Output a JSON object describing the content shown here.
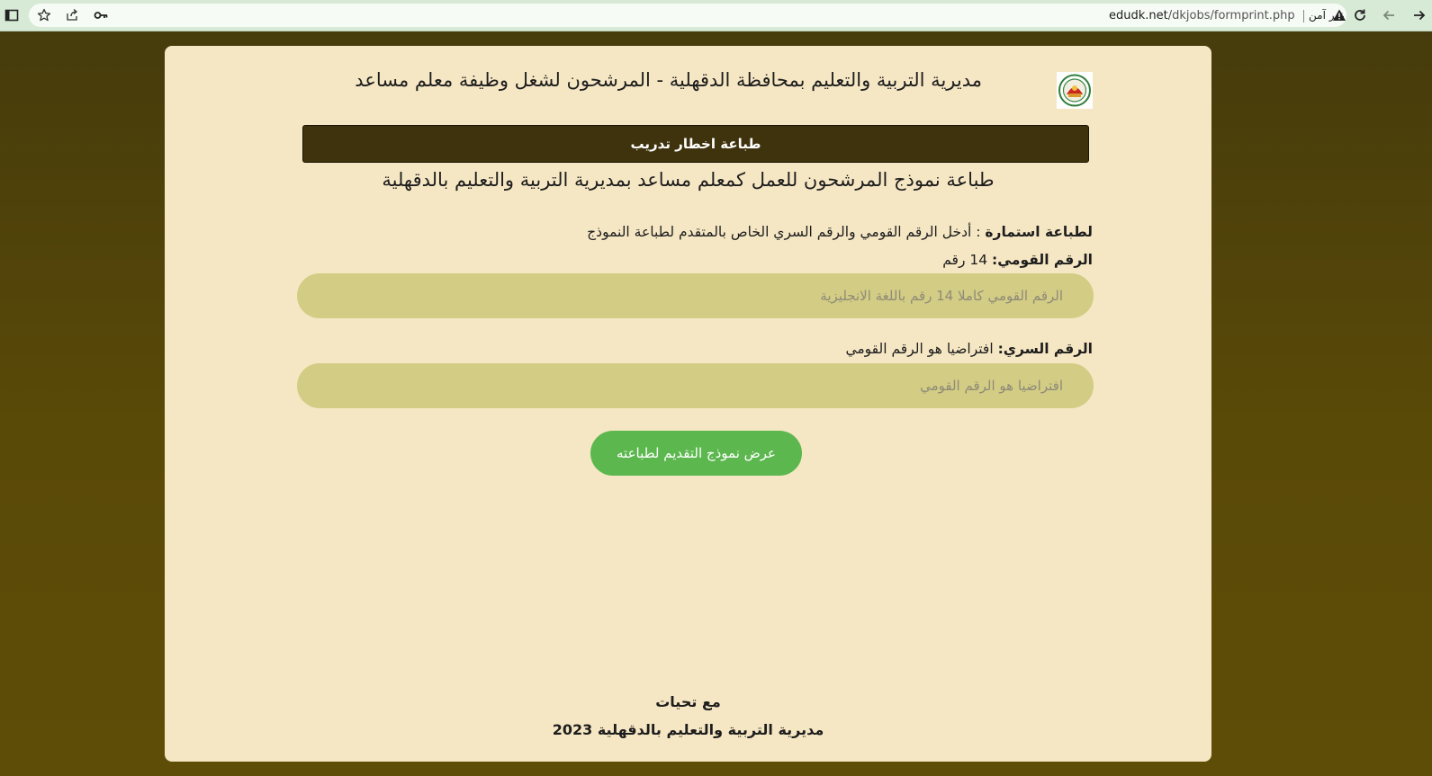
{
  "browser": {
    "url_host": "edudk.net",
    "url_path": "/dkjobs/formprint.php",
    "security_label": "غير آمن",
    "icons": [
      "sidebar-icon",
      "star-icon",
      "share-icon",
      "key-icon",
      "warning-icon",
      "reload-icon",
      "back-icon",
      "forward-icon"
    ]
  },
  "page": {
    "header_title": "مديرية التربية والتعليم بمحافظة الدقهلية - المرشحون لشغل وظيفة معلم مساعد",
    "banner": "طباعة اخطار تدريب",
    "subtitle": "طباعة نموذج المرشحون للعمل كمعلم مساعد بمديرية التربية والتعليم بالدقهلية",
    "instruction_label": "لطباعة استمارة",
    "instruction_text": " : أدخل الرقم القومي والرقم السري الخاص بالمتقدم لطباعة النموذج",
    "national_id_label": "الرقم القومي:",
    "national_id_hint": " 14 رقم",
    "national_id_placeholder": "الرقم القومي كاملا 14 رقم باللغة الانجليزية",
    "password_label": "الرقم السري:",
    "password_hint": " افتراضيا هو الرقم القومي",
    "password_placeholder": "افتراضيا هو الرقم القومي",
    "submit_label": "عرض نموذج التقديم لطباعته",
    "footer_greeting": "مع تحيات",
    "footer_org": "مديرية التربية والتعليم بالدقهلية 2023"
  },
  "colors": {
    "background": "#4f420a",
    "card": "#f6e7c4",
    "banner": "#3f330d",
    "field": "#d3cc84",
    "button": "#5cb84e"
  }
}
